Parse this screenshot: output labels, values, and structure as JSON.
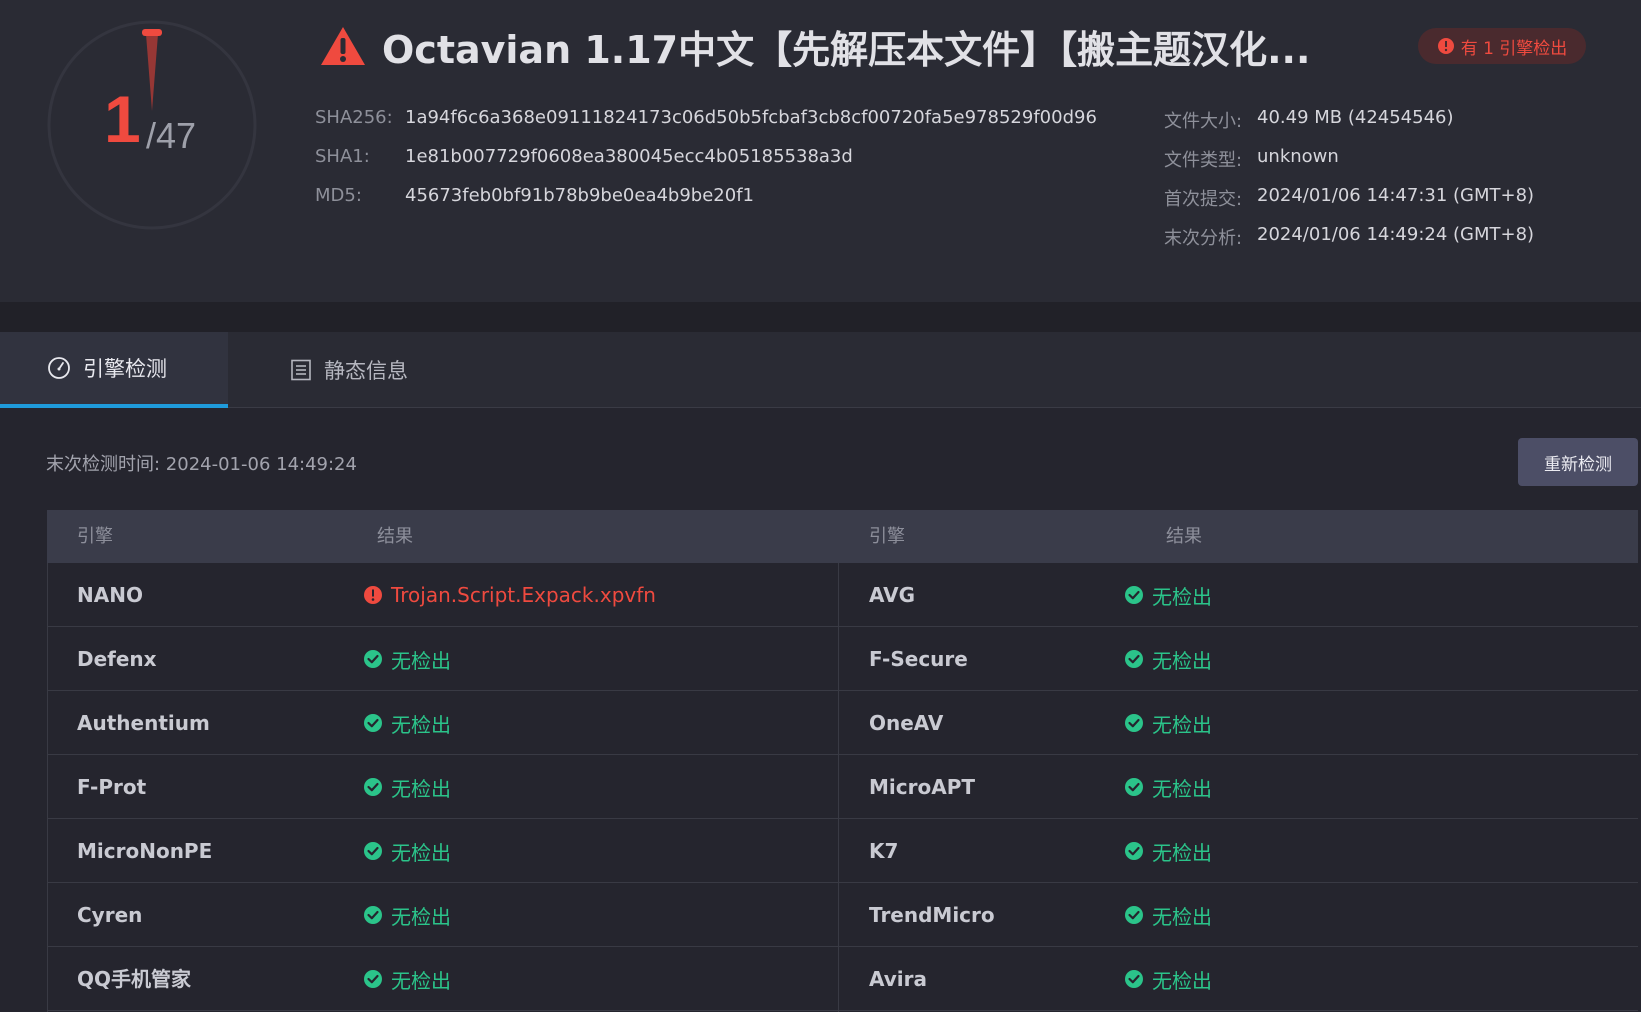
{
  "header": {
    "detected": "1",
    "total": "/47",
    "title": "Octavian 1.17中文【先解压本文件】【搬主题汉化...",
    "badge": "有 1 引擎检出",
    "hashes": [
      {
        "label": "SHA256:",
        "value": "1a94f6c6a368e09111824173c06d50b5fcbaf3cb8cf00720fa5e978529f00d96"
      },
      {
        "label": "SHA1:",
        "value": "1e81b007729f0608ea380045ecc4b05185538a3d"
      },
      {
        "label": "MD5:",
        "value": "45673feb0bf91b78b9be0ea4b9be20f1"
      }
    ],
    "file_info": [
      {
        "label": "文件大小:",
        "value": "40.49 MB (42454546)"
      },
      {
        "label": "文件类型:",
        "value": "unknown"
      },
      {
        "label": "首次提交:",
        "value": "2024/01/06 14:47:31 (GMT+8)"
      },
      {
        "label": "末次分析:",
        "value": "2024/01/06 14:49:24 (GMT+8)"
      }
    ]
  },
  "tabs": [
    {
      "label": "引擎检测",
      "icon": "gauge-icon",
      "active": true
    },
    {
      "label": "静态信息",
      "icon": "list-icon",
      "active": false
    }
  ],
  "scan": {
    "last_scan": "末次检测时间: 2024-01-06 14:49:24",
    "rescan_label": "重新检测"
  },
  "table": {
    "headers": [
      "引擎",
      "结果",
      "引擎",
      "结果"
    ],
    "rows": [
      {
        "left": {
          "engine": "NANO",
          "result": "Trojan.Script.Expack.xpvfn",
          "status": "detected"
        },
        "right": {
          "engine": "AVG",
          "result": "无检出",
          "status": "clean"
        }
      },
      {
        "left": {
          "engine": "Defenx",
          "result": "无检出",
          "status": "clean"
        },
        "right": {
          "engine": "F-Secure",
          "result": "无检出",
          "status": "clean"
        }
      },
      {
        "left": {
          "engine": "Authentium",
          "result": "无检出",
          "status": "clean"
        },
        "right": {
          "engine": "OneAV",
          "result": "无检出",
          "status": "clean"
        }
      },
      {
        "left": {
          "engine": "F-Prot",
          "result": "无检出",
          "status": "clean"
        },
        "right": {
          "engine": "MicroAPT",
          "result": "无检出",
          "status": "clean"
        }
      },
      {
        "left": {
          "engine": "MicroNonPE",
          "result": "无检出",
          "status": "clean"
        },
        "right": {
          "engine": "K7",
          "result": "无检出",
          "status": "clean"
        }
      },
      {
        "left": {
          "engine": "Cyren",
          "result": "无检出",
          "status": "clean"
        },
        "right": {
          "engine": "TrendMicro",
          "result": "无检出",
          "status": "clean"
        }
      },
      {
        "left": {
          "engine": "QQ手机管家",
          "result": "无检出",
          "status": "clean"
        },
        "right": {
          "engine": "Avira",
          "result": "无检出",
          "status": "clean"
        }
      }
    ]
  },
  "colors": {
    "detected": "#ef4a3f",
    "clean": "#2bc48a",
    "accent_tab": "#1f9bdb"
  }
}
